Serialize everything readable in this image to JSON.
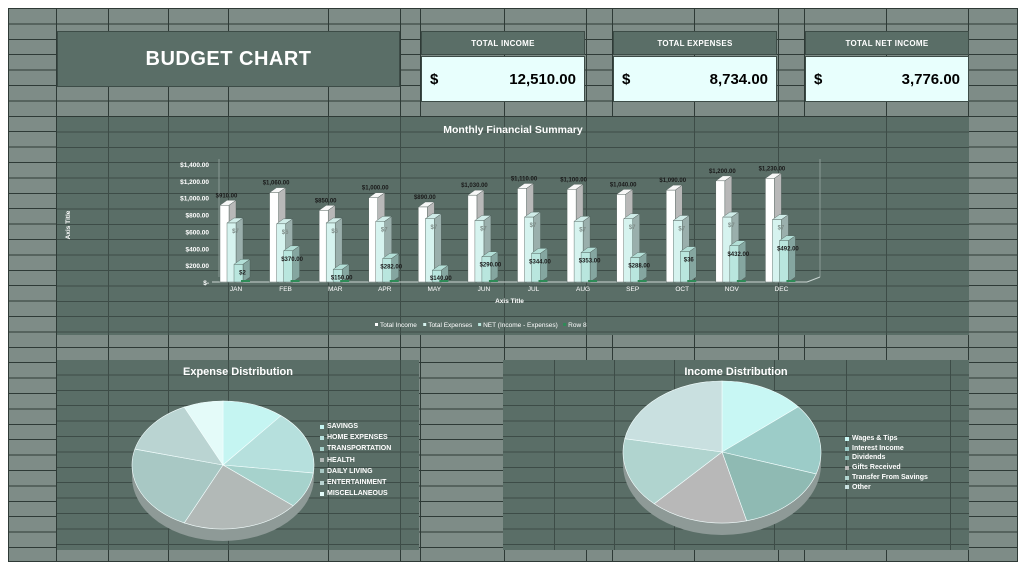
{
  "header": {
    "title": "BUDGET CHART"
  },
  "kpis": [
    {
      "label": "TOTAL INCOME",
      "currency": "$",
      "value": "12,510.00"
    },
    {
      "label": "TOTAL EXPENSES",
      "currency": "$",
      "value": "8,734.00"
    },
    {
      "label": "TOTAL NET INCOME",
      "currency": "$",
      "value": "3,776.00"
    }
  ],
  "charts": {
    "summary_title": "Monthly Financial Summary",
    "expense_title": "Expense Distribution",
    "income_title": "Income Distribution"
  },
  "colors": {
    "panel": "#5a6e67",
    "sheet": "#7e8c87",
    "kpi_fill": "#e8fffd",
    "bar_income": "#ffffff",
    "bar_expense": "#d6f3ef",
    "bar_net": "#b9e6de",
    "bar_row8": "#2e8b57"
  },
  "chart_data": [
    {
      "type": "bar",
      "title": "Monthly Financial Summary",
      "xlabel": "Axis Title",
      "ylabel": "Axis Title",
      "ylim": [
        0,
        1400
      ],
      "y_ticks": [
        "$-",
        "$200.00",
        "$400.00",
        "$600.00",
        "$800.00",
        "$1,000.00",
        "$1,200.00",
        "$1,400.00"
      ],
      "y_tick_values": [
        0,
        200,
        400,
        600,
        800,
        1000,
        1200,
        1400
      ],
      "categories": [
        "JAN",
        "FEB",
        "MAR",
        "APR",
        "MAY",
        "JUN",
        "JUL",
        "AUG",
        "SEP",
        "OCT",
        "NOV",
        "DEC"
      ],
      "legend_position": "bottom",
      "grid": false,
      "series": [
        {
          "name": "Total Income",
          "values": [
            910,
            1060,
            850,
            1000,
            890,
            1030,
            1110,
            1100,
            1040,
            1090,
            1200,
            1230
          ],
          "labels": [
            "$910.00",
            "$1,060.00",
            "$850.00",
            "$1,000.00",
            "$890.00",
            "$1,030.00",
            "$1,110.00",
            "$1,100.00",
            "$1,040.00",
            "$1,090.00",
            "$1,200.00",
            "$1,230.00"
          ]
        },
        {
          "name": "Total Expenses",
          "values": [
            700,
            690,
            700,
            720,
            750,
            730,
            770,
            720,
            750,
            730,
            770,
            740
          ],
          "labels": [
            "$7",
            "$6",
            "$6",
            "$7",
            "$7",
            "$7",
            "$7",
            "$7",
            "$7",
            "$7",
            "$7",
            "$7"
          ]
        },
        {
          "name": "NET (Income - Expenses)",
          "values": [
            210,
            370,
            150,
            280,
            140,
            300,
            340,
            350,
            290,
            360,
            430,
            490
          ],
          "labels": [
            "$2",
            "$370.00",
            "$150.00",
            "$282.00",
            "$140.00",
            "$290.00",
            "$344.00",
            "$353.00",
            "$288.00",
            "$36",
            "$432.00",
            "$492.00"
          ]
        },
        {
          "name": "Row 8",
          "values": [
            0,
            0,
            0,
            0,
            0,
            0,
            0,
            0,
            0,
            0,
            0,
            0
          ],
          "labels": []
        }
      ]
    },
    {
      "type": "pie",
      "title": "Expense Distribution",
      "categories": [
        "SAVINGS",
        "HOME EXPENSES",
        "TRANSPORTATION",
        "HEALTH",
        "DAILY LIVING",
        "ENTERTAINMENT",
        "MISCELLANEOUS"
      ],
      "values": [
        11,
        16,
        9,
        21,
        22,
        14,
        7
      ],
      "colors": [
        "#c5f5f2",
        "#b6e0dd",
        "#a6d2cc",
        "#b2b9b7",
        "#a8c8c4",
        "#bad4d2",
        "#e4fbf9"
      ],
      "legend_position": "right"
    },
    {
      "type": "pie",
      "title": "Income Distribution",
      "categories": [
        "Wages & Tips",
        "Interest Income",
        "Dividends",
        "Gifts Received",
        "Transfer From Savings",
        "Other"
      ],
      "values": [
        14,
        16,
        16,
        16,
        16,
        22
      ],
      "colors": [
        "#c8f7f4",
        "#9cccc8",
        "#8fbab3",
        "#b8b8b8",
        "#b0d4cf",
        "#c9e0e0"
      ],
      "legend_position": "right"
    }
  ]
}
